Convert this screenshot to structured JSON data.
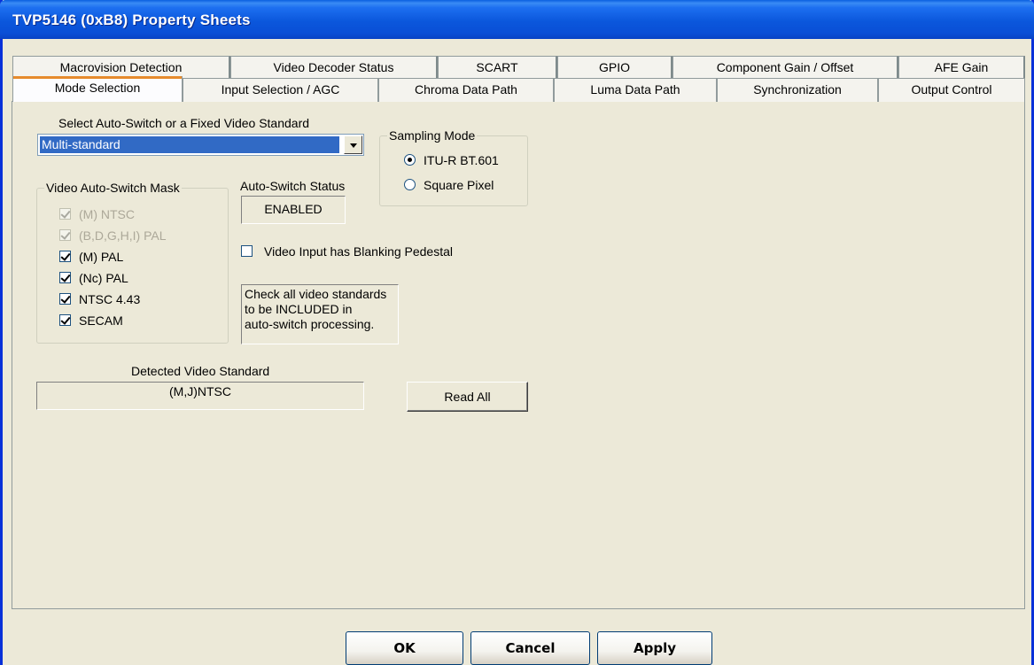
{
  "window": {
    "title": "TVP5146 (0xB8) Property Sheets"
  },
  "tabs": {
    "back_row": [
      "Macrovision Detection",
      "Video Decoder Status",
      "SCART",
      "GPIO",
      "Component Gain / Offset",
      "AFE Gain"
    ],
    "front_row": [
      "Mode Selection",
      "Input Selection / AGC",
      "Chroma Data Path",
      "Luma Data Path",
      "Synchronization",
      "Output Control"
    ],
    "active": "Mode Selection"
  },
  "mode": {
    "standard_label": "Select Auto-Switch or a Fixed Video Standard",
    "standard_value": "Multi-standard",
    "sampling": {
      "legend": "Sampling Mode",
      "options": [
        "ITU-R BT.601",
        "Square Pixel"
      ],
      "selected": "ITU-R BT.601"
    },
    "mask": {
      "legend": "Video Auto-Switch Mask",
      "items": [
        {
          "label": "(M) NTSC",
          "checked": true,
          "enabled": false
        },
        {
          "label": "(B,D,G,H,I) PAL",
          "checked": true,
          "enabled": false
        },
        {
          "label": "(M) PAL",
          "checked": true,
          "enabled": true
        },
        {
          "label": "(Nc) PAL",
          "checked": true,
          "enabled": true
        },
        {
          "label": "NTSC 4.43",
          "checked": true,
          "enabled": true
        },
        {
          "label": "SECAM",
          "checked": true,
          "enabled": true
        }
      ]
    },
    "auto_switch_status_label": "Auto-Switch Status",
    "auto_switch_status_value": "ENABLED",
    "blanking_pedestal_label": "Video Input has Blanking Pedestal",
    "blanking_pedestal_checked": false,
    "hint_lines": [
      "Check all video standards",
      "to be INCLUDED in",
      "auto-switch processing."
    ],
    "detected_label": "Detected Video Standard",
    "detected_value": "(M,J)NTSC",
    "read_all_label": "Read All"
  },
  "buttons": {
    "ok": "OK",
    "cancel": "Cancel",
    "apply": "Apply"
  }
}
